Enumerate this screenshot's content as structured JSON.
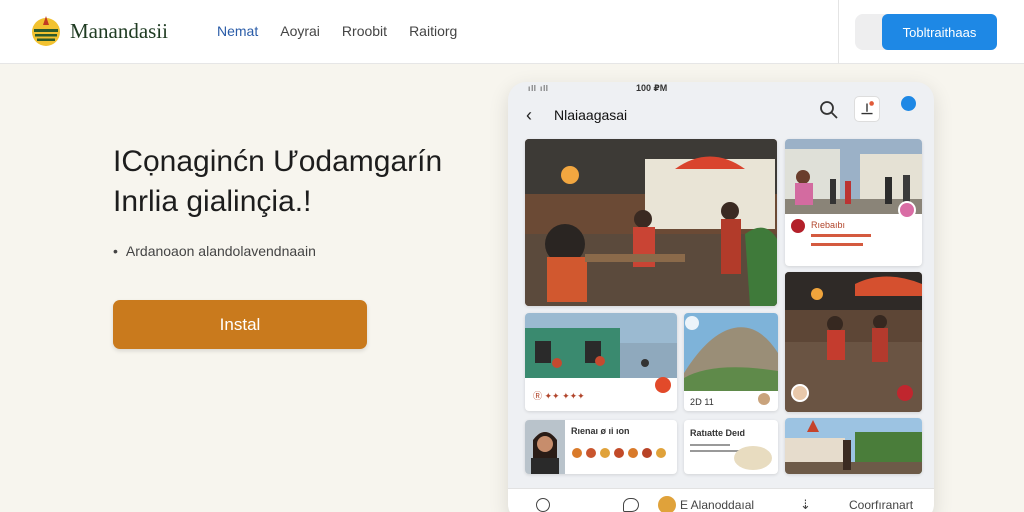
{
  "header": {
    "brand_name": "Manandasii",
    "nav": [
      "Nemat",
      "Aoyrai",
      "Rroobit",
      "Raitiorg"
    ],
    "cta_label": "Tobltraithaas"
  },
  "hero": {
    "title_line1": "ICọnaginćn Ưodamgarín",
    "title_line2": "Inrlia gialinçia.!",
    "subtitle": "Ardanoaon alandolavendnaain",
    "install_label": "Instal"
  },
  "phone": {
    "status_left": "ıll ıll",
    "status_time": "100 ₽M",
    "app_title": "Nlaiaagasai",
    "cards": {
      "c2_caption": "Rıebaıbı",
      "c4_caption": "Ⓡ ✦✦ ✦✦✦",
      "c5_caption": "2Ⅾ 11",
      "c7_caption": "Rıenaı ø ıi ıon",
      "c8_caption": "Ratıatte Deıd"
    },
    "bottom_nav": [
      "E Alanoddaıal",
      "Coorfıranart"
    ]
  }
}
